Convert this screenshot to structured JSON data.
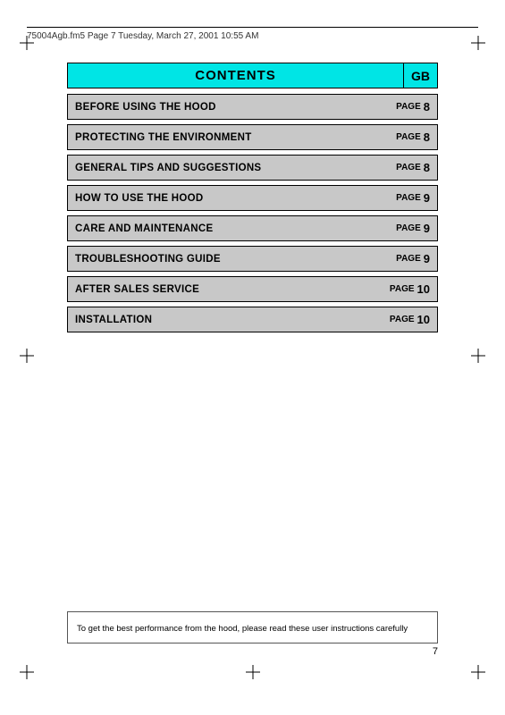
{
  "header": {
    "filename": "75004Agb.fm5  Page 7  Tuesday, March 27, 2001  10:55 AM"
  },
  "contents": {
    "title": "CONTENTS",
    "gb_label": "GB"
  },
  "toc_items": [
    {
      "title": "BEFORE USING THE HOOD",
      "page_label": "PAGE",
      "page_number": "8"
    },
    {
      "title": "PROTECTING THE ENVIRONMENT",
      "page_label": "PAGE",
      "page_number": "8"
    },
    {
      "title": "GENERAL TIPS AND SUGGESTIONS",
      "page_label": "PAGE",
      "page_number": "8"
    },
    {
      "title": "HOW TO USE THE HOOD",
      "page_label": "PAGE",
      "page_number": "9"
    },
    {
      "title": "CARE AND MAINTENANCE",
      "page_label": "PAGE",
      "page_number": "9"
    },
    {
      "title": "TROUBLESHOOTING GUIDE",
      "page_label": "PAGE",
      "page_number": "9"
    },
    {
      "title": "AFTER SALES SERVICE",
      "page_label": "PAGE",
      "page_number": "10"
    },
    {
      "title": "INSTALLATION",
      "page_label": "PAGE",
      "page_number": "10"
    }
  ],
  "bottom_note": "To get the best performance from the hood, please read these user instructions carefully",
  "page_number": "7"
}
